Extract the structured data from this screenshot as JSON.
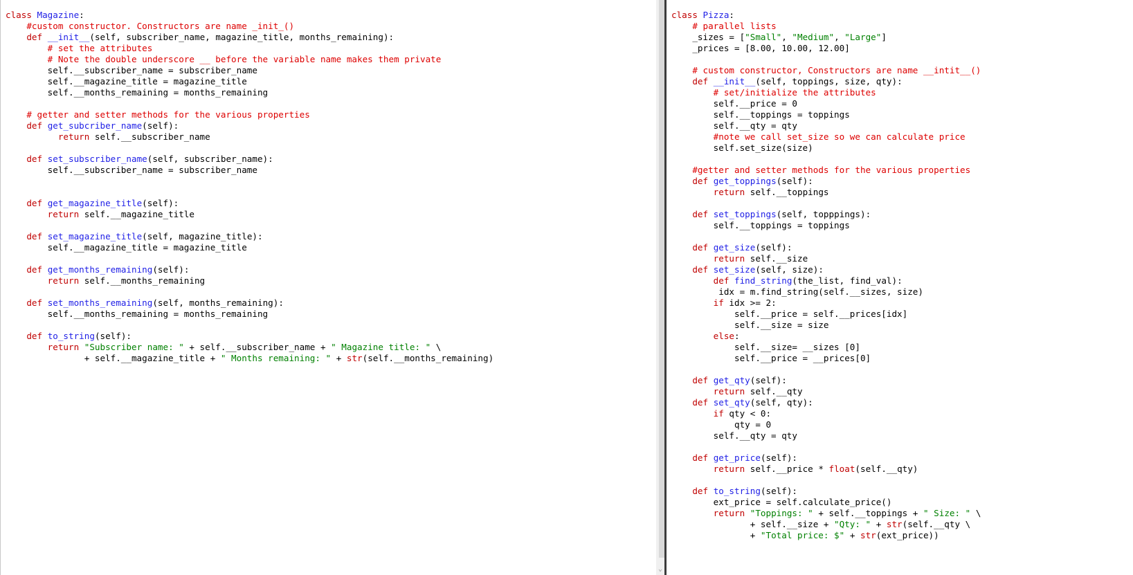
{
  "editors": [
    {
      "name": "magazine-editor",
      "lines": [
        [
          [
            "k",
            "class "
          ],
          [
            "b",
            "Magazine"
          ],
          [
            "d",
            ":"
          ]
        ],
        [
          [
            "d",
            "    "
          ],
          [
            "c",
            "#custom constructor. Constructors are name _init_()"
          ]
        ],
        [
          [
            "d",
            "    "
          ],
          [
            "k",
            "def "
          ],
          [
            "b",
            "__init__"
          ],
          [
            "d",
            "(self, subscriber_name, magazine_title, months_remaining):"
          ]
        ],
        [
          [
            "d",
            "        "
          ],
          [
            "c",
            "# set the attributes"
          ]
        ],
        [
          [
            "d",
            "        "
          ],
          [
            "c",
            "# Note the double underscore __ before the variable name makes them private"
          ]
        ],
        [
          [
            "d",
            "        self.__subscriber_name = subscriber_name"
          ]
        ],
        [
          [
            "d",
            "        self.__magazine_title = magazine_title"
          ]
        ],
        [
          [
            "d",
            "        self.__months_remaining = months_remaining"
          ]
        ],
        [],
        [
          [
            "d",
            "    "
          ],
          [
            "c",
            "# getter and setter methods for the various properties"
          ]
        ],
        [
          [
            "d",
            "    "
          ],
          [
            "k",
            "def "
          ],
          [
            "b",
            "get_subcriber_name"
          ],
          [
            "d",
            "(self):"
          ]
        ],
        [
          [
            "d",
            "          "
          ],
          [
            "k",
            "return "
          ],
          [
            "d",
            "self.__subscriber_name"
          ]
        ],
        [],
        [
          [
            "d",
            "    "
          ],
          [
            "k",
            "def "
          ],
          [
            "b",
            "set_subscriber_name"
          ],
          [
            "d",
            "(self, subscriber_name):"
          ]
        ],
        [
          [
            "d",
            "        self.__subscriber_name = subscriber_name"
          ]
        ],
        [],
        [],
        [
          [
            "d",
            "    "
          ],
          [
            "k",
            "def "
          ],
          [
            "b",
            "get_magazine_title"
          ],
          [
            "d",
            "(self):"
          ]
        ],
        [
          [
            "d",
            "        "
          ],
          [
            "k",
            "return "
          ],
          [
            "d",
            "self.__magazine_title"
          ]
        ],
        [],
        [
          [
            "d",
            "    "
          ],
          [
            "k",
            "def "
          ],
          [
            "b",
            "set_magazine_title"
          ],
          [
            "d",
            "(self, magazine_title):"
          ]
        ],
        [
          [
            "d",
            "        self.__magazine_title = magazine_title"
          ]
        ],
        [],
        [
          [
            "d",
            "    "
          ],
          [
            "k",
            "def "
          ],
          [
            "b",
            "get_months_remaining"
          ],
          [
            "d",
            "(self):"
          ]
        ],
        [
          [
            "d",
            "        "
          ],
          [
            "k",
            "return "
          ],
          [
            "d",
            "self.__months_remaining"
          ]
        ],
        [],
        [
          [
            "d",
            "    "
          ],
          [
            "k",
            "def "
          ],
          [
            "b",
            "set_months_remaining"
          ],
          [
            "d",
            "(self, months_remaining):"
          ]
        ],
        [
          [
            "d",
            "        self.__months_remaining = months_remaining"
          ]
        ],
        [],
        [
          [
            "d",
            "    "
          ],
          [
            "k",
            "def "
          ],
          [
            "b",
            "to_string"
          ],
          [
            "d",
            "(self):"
          ]
        ],
        [
          [
            "d",
            "        "
          ],
          [
            "k",
            "return "
          ],
          [
            "s",
            "\"Subscriber name: \""
          ],
          [
            "d",
            " + self.__subscriber_name + "
          ],
          [
            "s",
            "\" Magazine title: \""
          ],
          [
            "d",
            " \\"
          ]
        ],
        [
          [
            "d",
            "               + self.__magazine_title + "
          ],
          [
            "s",
            "\" Months remaining: \""
          ],
          [
            "d",
            " + "
          ],
          [
            "k",
            "str"
          ],
          [
            "d",
            "(self.__months_remaining)"
          ]
        ]
      ]
    },
    {
      "name": "pizza-editor",
      "lines": [
        [
          [
            "k",
            "class "
          ],
          [
            "b",
            "Pizza"
          ],
          [
            "d",
            ":"
          ]
        ],
        [
          [
            "d",
            "    "
          ],
          [
            "c",
            "# parallel lists"
          ]
        ],
        [
          [
            "d",
            "    _sizes = ["
          ],
          [
            "s",
            "\"Small\""
          ],
          [
            "d",
            ", "
          ],
          [
            "s",
            "\"Medium\""
          ],
          [
            "d",
            ", "
          ],
          [
            "s",
            "\"Large\""
          ],
          [
            "d",
            "]"
          ]
        ],
        [
          [
            "d",
            "    _prices = [8.00, 10.00, 12.00]"
          ]
        ],
        [],
        [
          [
            "d",
            "    "
          ],
          [
            "c",
            "# custom constructor, Constructors are name __intit__()"
          ]
        ],
        [
          [
            "d",
            "    "
          ],
          [
            "k",
            "def "
          ],
          [
            "b",
            "__init__"
          ],
          [
            "d",
            "(self, toppings, size, qty):"
          ]
        ],
        [
          [
            "d",
            "        "
          ],
          [
            "c",
            "# set/initialize the attributes"
          ]
        ],
        [
          [
            "d",
            "        self.__price = 0"
          ]
        ],
        [
          [
            "d",
            "        self.__toppings = toppings"
          ]
        ],
        [
          [
            "d",
            "        self.__qty = qty"
          ]
        ],
        [
          [
            "d",
            "        "
          ],
          [
            "c",
            "#note we call set_size so we can calculate price"
          ]
        ],
        [
          [
            "d",
            "        self.set_size(size)"
          ]
        ],
        [],
        [
          [
            "d",
            "    "
          ],
          [
            "c",
            "#getter and setter methods for the various properties"
          ]
        ],
        [
          [
            "d",
            "    "
          ],
          [
            "k",
            "def "
          ],
          [
            "b",
            "get_toppings"
          ],
          [
            "d",
            "(self):"
          ]
        ],
        [
          [
            "d",
            "        "
          ],
          [
            "k",
            "return "
          ],
          [
            "d",
            "self.__toppings"
          ]
        ],
        [],
        [
          [
            "d",
            "    "
          ],
          [
            "k",
            "def "
          ],
          [
            "b",
            "set_toppings"
          ],
          [
            "d",
            "(self, topppings):"
          ]
        ],
        [
          [
            "d",
            "        self.__toppings = toppings"
          ]
        ],
        [],
        [
          [
            "d",
            "    "
          ],
          [
            "k",
            "def "
          ],
          [
            "b",
            "get_size"
          ],
          [
            "d",
            "(self):"
          ]
        ],
        [
          [
            "d",
            "        "
          ],
          [
            "k",
            "return "
          ],
          [
            "d",
            "self.__size"
          ]
        ],
        [
          [
            "d",
            "    "
          ],
          [
            "k",
            "def "
          ],
          [
            "b",
            "set_size"
          ],
          [
            "d",
            "(self, size):"
          ]
        ],
        [
          [
            "d",
            "        "
          ],
          [
            "k",
            "def "
          ],
          [
            "b",
            "find_string"
          ],
          [
            "d",
            "(the_list, find_val):"
          ]
        ],
        [
          [
            "d",
            "         idx = m.find_string(self.__sizes, size)"
          ]
        ],
        [
          [
            "d",
            "        "
          ],
          [
            "k",
            "if "
          ],
          [
            "d",
            "idx >= 2:"
          ]
        ],
        [
          [
            "d",
            "            self.__price = self.__prices[idx]"
          ]
        ],
        [
          [
            "d",
            "            self.__size = size"
          ]
        ],
        [
          [
            "d",
            "        "
          ],
          [
            "k",
            "else"
          ],
          [
            "d",
            ":"
          ]
        ],
        [
          [
            "d",
            "            self.__size= __sizes [0]"
          ]
        ],
        [
          [
            "d",
            "            self.__price = __prices[0]"
          ]
        ],
        [],
        [
          [
            "d",
            "    "
          ],
          [
            "k",
            "def "
          ],
          [
            "b",
            "get_qty"
          ],
          [
            "d",
            "(self):"
          ]
        ],
        [
          [
            "d",
            "        "
          ],
          [
            "k",
            "return "
          ],
          [
            "d",
            "self.__qty"
          ]
        ],
        [
          [
            "d",
            "    "
          ],
          [
            "k",
            "def "
          ],
          [
            "b",
            "set_qty"
          ],
          [
            "d",
            "(self, qty):"
          ]
        ],
        [
          [
            "d",
            "        "
          ],
          [
            "k",
            "if "
          ],
          [
            "d",
            "qty < 0:"
          ]
        ],
        [
          [
            "d",
            "            qty = 0"
          ]
        ],
        [
          [
            "d",
            "        self.__qty = qty"
          ]
        ],
        [],
        [
          [
            "d",
            "    "
          ],
          [
            "k",
            "def "
          ],
          [
            "b",
            "get_price"
          ],
          [
            "d",
            "(self):"
          ]
        ],
        [
          [
            "d",
            "        "
          ],
          [
            "k",
            "return "
          ],
          [
            "d",
            "self.__price * "
          ],
          [
            "k",
            "float"
          ],
          [
            "d",
            "(self.__qty)"
          ]
        ],
        [],
        [
          [
            "d",
            "    "
          ],
          [
            "k",
            "def "
          ],
          [
            "b",
            "to_string"
          ],
          [
            "d",
            "(self):"
          ]
        ],
        [
          [
            "d",
            "        ext_price = self.calculate_price()"
          ]
        ],
        [
          [
            "d",
            "        "
          ],
          [
            "k",
            "return "
          ],
          [
            "s",
            "\"Toppings: \""
          ],
          [
            "d",
            " + self.__toppings + "
          ],
          [
            "s",
            "\" Size: \""
          ],
          [
            "d",
            " \\"
          ]
        ],
        [
          [
            "d",
            "               + self.__size + "
          ],
          [
            "s",
            "\"Qty: \""
          ],
          [
            "d",
            " + "
          ],
          [
            "k",
            "str"
          ],
          [
            "d",
            "(self.__qty \\"
          ]
        ],
        [
          [
            "d",
            "               + "
          ],
          [
            "s",
            "\"Total price: $\""
          ],
          [
            "d",
            " + "
          ],
          [
            "k",
            "str"
          ],
          [
            "d",
            "(ext_price))"
          ]
        ]
      ]
    }
  ],
  "colors": {
    "keyword": "#c00000",
    "name": "#1e1ee6",
    "comment": "#dd0000",
    "string": "#008000",
    "default": "#000000"
  },
  "scrollbar": {
    "arrow_icon": "chevron-down-icon"
  }
}
